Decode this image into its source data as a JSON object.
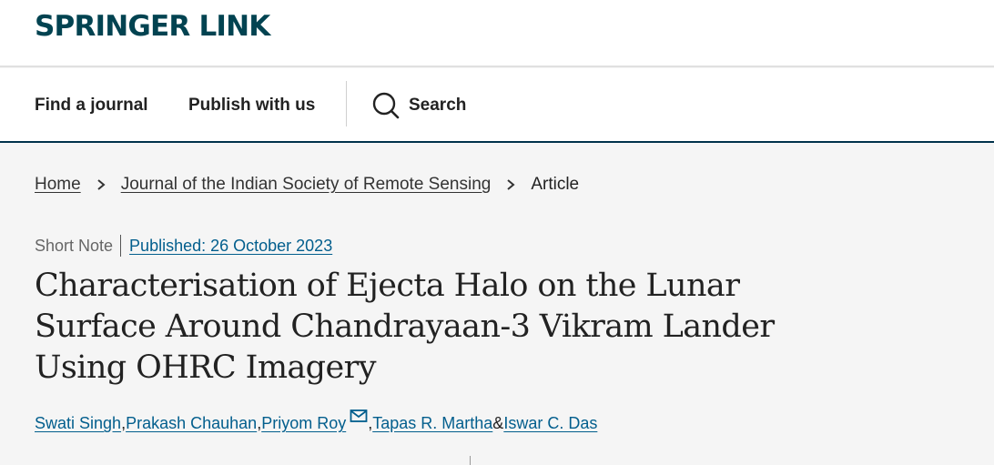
{
  "header": {
    "logo": "SPRINGER LINK"
  },
  "nav": {
    "find_journal": "Find a journal",
    "publish": "Publish with us",
    "search": "Search"
  },
  "breadcrumb": {
    "home": "Home",
    "journal": "Journal of the Indian Society of Remote Sensing",
    "current": "Article"
  },
  "article": {
    "type": "Short Note",
    "published": "Published: 26 October 2023",
    "title": "Characterisation of Ejecta Halo on the Lunar Surface Around Chandrayaan-3 Vikram Lander Using OHRC Imagery",
    "authors": [
      "Swati Singh",
      "Prakash Chauhan",
      "Priyom Roy",
      "Tapas R. Martha",
      "Iswar C. Das"
    ],
    "separators": {
      "comma": ", ",
      "amp": " & "
    }
  },
  "colors": {
    "brand": "#024351",
    "link": "#025e8d",
    "nav_border": "#01324b"
  },
  "icons": {
    "search": "search-icon",
    "chevron": "chevron-right-icon",
    "mail": "mail-icon"
  }
}
